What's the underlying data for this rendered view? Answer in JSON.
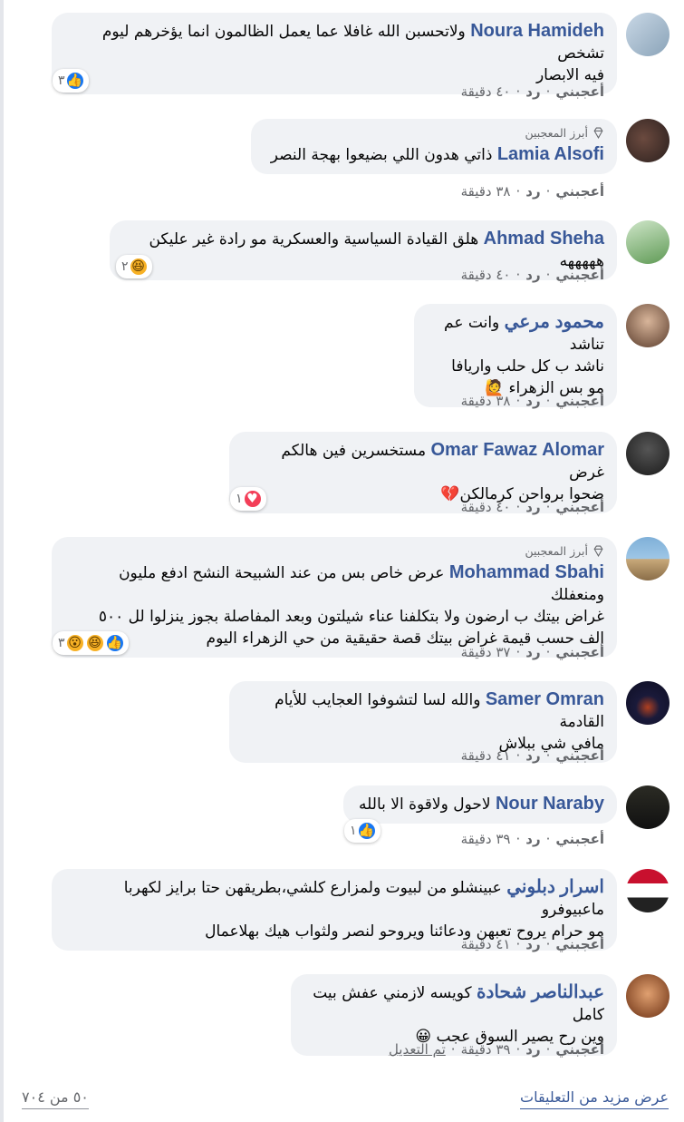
{
  "top_fan_label": "أبرز المعجبين",
  "action_labels": {
    "like": "أعجبني",
    "reply": "رد"
  },
  "comments": [
    {
      "name": "Noura Hamideh",
      "lines": [
        "ولاتحسبن الله غافلا عما يعمل الظالمون انما يؤخرهم ليوم تشخص",
        "فيه الابصار"
      ],
      "time": "٤٠ دقيقة",
      "reactions": [
        "like"
      ],
      "reaction_count": "٣"
    },
    {
      "name": "Lamia Alsofi",
      "top_fan": true,
      "lines": [
        "ذاتي هدون اللي بضيعوا بهجة النصر"
      ],
      "time": "٣٨ دقيقة"
    },
    {
      "name": "Ahmad Sheha",
      "lines": [
        "هلق القيادة السياسية والعسكرية مو رادة غير عليكن هههههه"
      ],
      "time": "٤٠ دقيقة",
      "reactions": [
        "haha"
      ],
      "reaction_count": "٢"
    },
    {
      "name": "محمود مرعي",
      "lines": [
        "وانت عم تناشد",
        "ناشد ب كل حلب واريافا",
        "مو بس الزهراء 🙋"
      ],
      "time": "٣٨ دقيقة"
    },
    {
      "name": "Omar Fawaz Alomar",
      "lines": [
        "مستخسرين فين هالكم غرض",
        "ضحوا برواحن كرمالكن💔"
      ],
      "time": "٤٠ دقيقة",
      "reactions": [
        "love"
      ],
      "reaction_count": "١"
    },
    {
      "name": "Mohammad Sbahi",
      "top_fan": true,
      "lines": [
        "عرض خاص بس من عند الشبيحة النشح ادفع مليون ومنعفلك",
        "غراض بيتك ب ارضون ولا بتكلفنا عناء شيلتون وبعد المفاصلة بجوز ينزلوا لل ٥٠٠",
        "الف حسب قيمة غراض بيتك قصة حقيقية من حي الزهراء اليوم"
      ],
      "time": "٣٧ دقيقة",
      "reactions": [
        "like",
        "haha",
        "wow"
      ],
      "reaction_count": "٣"
    },
    {
      "name": "Samer Omran",
      "lines": [
        "والله لسا لتشوفوا العجايب للأيام القادمة",
        "مافي شي ببلاش"
      ],
      "time": "٤١ دقيقة"
    },
    {
      "name": "Nour Naraby",
      "lines": [
        "لاحول ولاقوة الا بالله"
      ],
      "time": "٣٩ دقيقة",
      "reactions": [
        "like"
      ],
      "reaction_count": "١"
    },
    {
      "name": "اسرار دبلوني",
      "lines": [
        "عبينشلو من لبيوت ولمزارع كلشي،بطريقهن حتا برايز لكهربا ماعبيوفرو",
        "مو حرام يروح تعبهن ودعائنا ويروحو لنصر ولثواب هيك بهلاعمال"
      ],
      "time": "٤١ دقيقة"
    },
    {
      "name": "عبدالناصر شحادة",
      "lines": [
        "كويسه لازمني عفش بيت كامل",
        "وين رح يصير السوق عجب 😀"
      ],
      "time": "٣٩ دقيقة",
      "edited": "تم التعديل"
    }
  ],
  "footer": {
    "more": "عرض مزيد من التعليقات",
    "count": "٥٠ من ٧٠٤"
  },
  "colors": {
    "name": "#385898",
    "bubble": "#f0f2f5",
    "meta": "#65676b",
    "like": "#1877f2",
    "love": "#f33e58",
    "haha": "#f7b125"
  }
}
